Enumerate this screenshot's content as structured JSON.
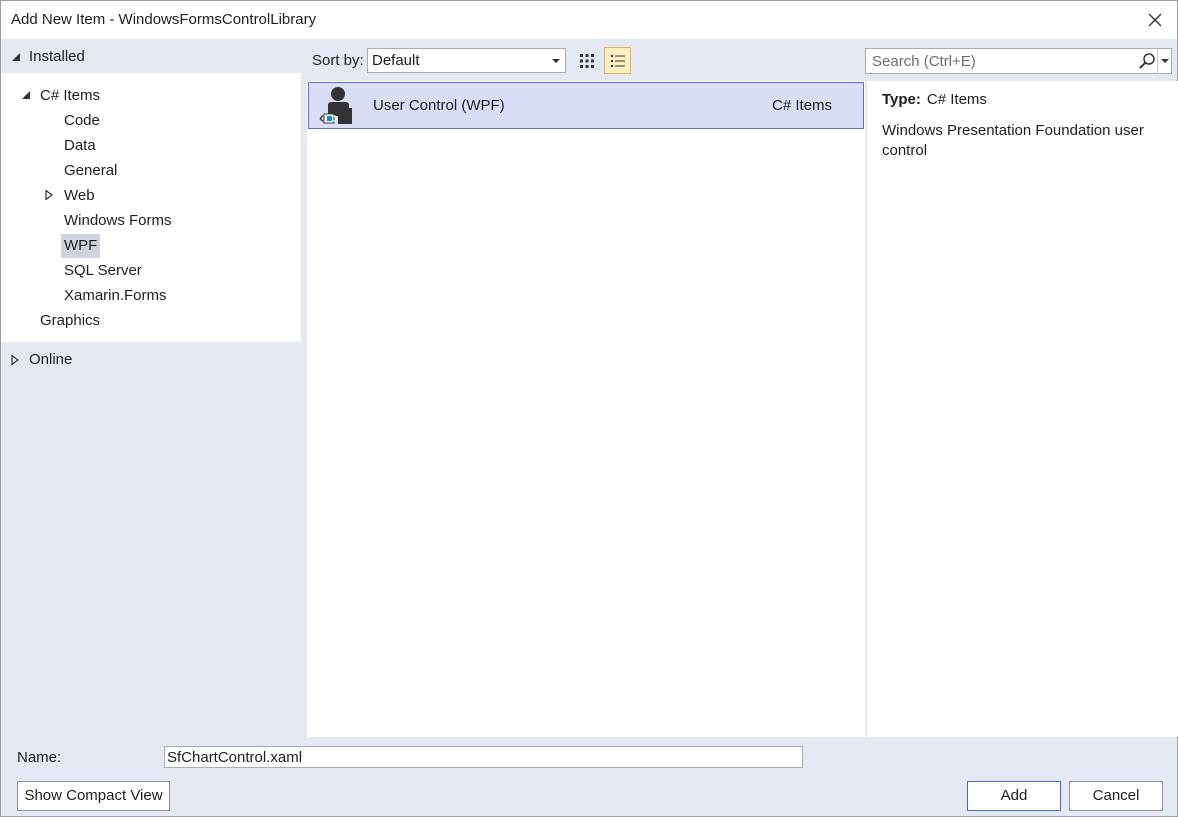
{
  "window": {
    "title": "Add New Item - WindowsFormsControlLibrary"
  },
  "tree": {
    "installed_label": "Installed",
    "csharp_items_label": "C# Items",
    "children": [
      "Code",
      "Data",
      "General",
      "Web",
      "Windows Forms",
      "WPF",
      "SQL Server",
      "Xamarin.Forms"
    ],
    "selected": "WPF",
    "graphics_label": "Graphics",
    "online_label": "Online"
  },
  "toolbar": {
    "sort_label": "Sort by:",
    "sort_value": "Default",
    "search_placeholder": "Search (Ctrl+E)"
  },
  "items": [
    {
      "name": "User Control (WPF)",
      "category": "C# Items",
      "icon": "user-control-wpf-icon"
    }
  ],
  "details": {
    "type_key": "Type:",
    "type_value": "C# Items",
    "description": "Windows Presentation Foundation user control"
  },
  "bottom": {
    "name_label": "Name:",
    "name_value": "SfChartControl.xaml",
    "compact_button": "Show Compact View",
    "add_button": "Add",
    "cancel_button": "Cancel"
  },
  "colors": {
    "background": "#e3e8f3",
    "selection_fill": "#d9ddf5",
    "selection_border": "#5b6fd6",
    "active_view_button": "#fdefc4"
  }
}
